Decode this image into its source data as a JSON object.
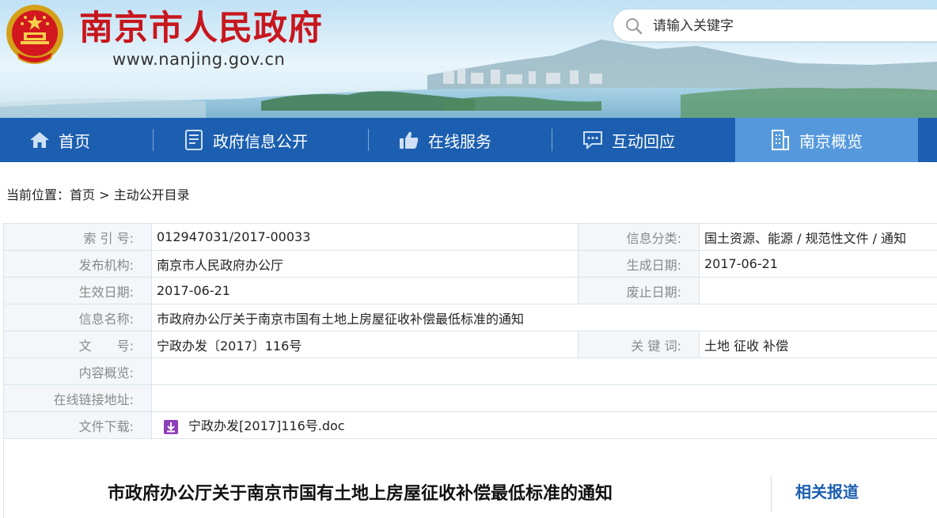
{
  "header": {
    "site_title": "南京市人民政府",
    "site_url": "www.nanjing.gov.cn",
    "search_placeholder": "请输入关键字",
    "title_color": "#c8161d"
  },
  "nav": {
    "items": [
      {
        "label": "首页",
        "icon": "home-icon"
      },
      {
        "label": "政府信息公开",
        "icon": "document-icon"
      },
      {
        "label": "在线服务",
        "icon": "thumbs-up-icon"
      },
      {
        "label": "互动回应",
        "icon": "chat-icon"
      },
      {
        "label": "南京概览",
        "icon": "building-icon",
        "active": true
      }
    ],
    "bg_color": "#1c5fb0",
    "active_color": "#5599dc"
  },
  "breadcrumb": {
    "prefix": "当前位置：",
    "home": "首页",
    "separator": " > ",
    "current": "主动公开目录"
  },
  "info": {
    "index_label": "索 引 号:",
    "index_value": "012947031/2017-00033",
    "category_label": "信息分类:",
    "category_value": "国土资源、能源 / 规范性文件 / 通知",
    "publisher_label": "发布机构:",
    "publisher_value": "南京市人民政府办公厅",
    "created_label": "生成日期:",
    "created_value": "2017-06-21",
    "effective_label": "生效日期:",
    "effective_value": "2017-06-21",
    "expiry_label": "废止日期:",
    "expiry_value": "",
    "name_label": "信息名称:",
    "name_value": "市政府办公厅关于南京市国有土地上房屋征收补偿最低标准的通知",
    "docno_label": "文　　号:",
    "docno_value": "宁政办发〔2017〕116号",
    "keywords_label": "关 键 词:",
    "keywords_value": "土地 征收 补偿",
    "summary_label": "内容概览:",
    "summary_value": "",
    "link_label": "在线链接地址:",
    "link_value": "",
    "download_label": "文件下载:",
    "download_value": "宁政办发[2017]116号.doc"
  },
  "content": {
    "doc_title": "市政府办公厅关于南京市国有土地上房屋征收补偿最低标准的通知",
    "related_label": "相关报道"
  }
}
